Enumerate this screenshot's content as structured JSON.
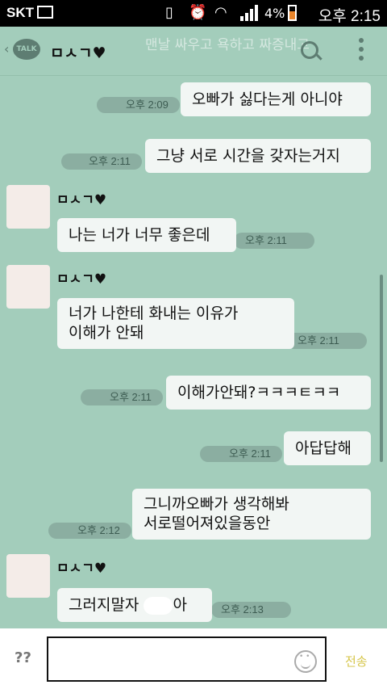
{
  "status_bar": {
    "carrier": "SKT",
    "battery": "4%",
    "battery_level": 0.04,
    "time": "오후 2:15"
  },
  "header": {
    "talk_logo": "TALK",
    "title": "ㅁㅅㄱ♥",
    "ghost_notice": "맨날 싸우고 욕하고 짜증내고"
  },
  "messages": [
    {
      "from": "me",
      "text": "오빠가 싫다는게 아니야",
      "time": "오후 2:09"
    },
    {
      "from": "me",
      "text": "그냥 서로 시간을 갖자는거지",
      "time": "오후 2:11"
    },
    {
      "from": "other",
      "sender": "ㅁㅅㄱ♥",
      "text": "나는 너가 너무 좋은데",
      "time": "오후 2:11"
    },
    {
      "from": "other",
      "sender": "ㅁㅅㄱ♥",
      "line1": "너가 나한테 화내는 이유가",
      "line2": "이해가 안돼",
      "time": "오후 2:11"
    },
    {
      "from": "me",
      "text": "이해가안돼?ㅋㅋㅋㅌㅋㅋ",
      "time": "오후 2:11"
    },
    {
      "from": "me",
      "text": "아답답해",
      "time": "오후 2:11"
    },
    {
      "from": "me",
      "line1": "그니까오빠가 생각해봐",
      "line2": "서로떨어져있을동안",
      "time": "오후 2:12"
    },
    {
      "from": "other",
      "sender": "ㅁㅅㄱ♥",
      "text_pre": "그러지말자 ",
      "text_post": "아",
      "time": "오후 2:13"
    }
  ],
  "input_bar": {
    "left_button": "??",
    "send_label": "전송"
  }
}
